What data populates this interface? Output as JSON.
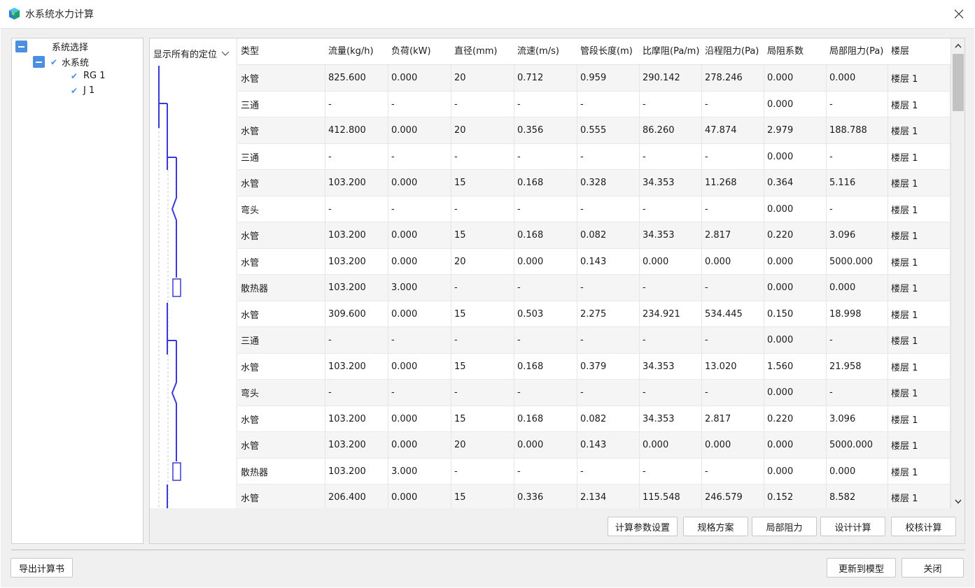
{
  "window": {
    "title": "水系统水力计算"
  },
  "tree": {
    "root_label": "系统选择",
    "system_label": "水系统",
    "children": [
      "RG 1",
      "J 1"
    ]
  },
  "diagram": {
    "header_label": "显示所有的定位"
  },
  "table": {
    "columns": [
      "类型",
      "流量(kg/h)",
      "负荷(kW)",
      "直径(mm)",
      "流速(m/s)",
      "管段长度(m)",
      "比摩阻(Pa/m)",
      "沿程阻力(Pa)",
      "局阻系数",
      "局部阻力(Pa)",
      "楼层"
    ],
    "rows": [
      [
        "水管",
        "825.600",
        "0.000",
        "20",
        "0.712",
        "0.959",
        "290.142",
        "278.246",
        "0.000",
        "0.000",
        "楼层 1"
      ],
      [
        "三通",
        "-",
        "-",
        "-",
        "-",
        "-",
        "-",
        "-",
        "0.000",
        "-",
        "楼层 1"
      ],
      [
        "水管",
        "412.800",
        "0.000",
        "20",
        "0.356",
        "0.555",
        "86.260",
        "47.874",
        "2.979",
        "188.788",
        "楼层 1"
      ],
      [
        "三通",
        "-",
        "-",
        "-",
        "-",
        "-",
        "-",
        "-",
        "0.000",
        "-",
        "楼层 1"
      ],
      [
        "水管",
        "103.200",
        "0.000",
        "15",
        "0.168",
        "0.328",
        "34.353",
        "11.268",
        "0.364",
        "5.116",
        "楼层 1"
      ],
      [
        "弯头",
        "-",
        "-",
        "-",
        "-",
        "-",
        "-",
        "-",
        "0.000",
        "-",
        "楼层 1"
      ],
      [
        "水管",
        "103.200",
        "0.000",
        "15",
        "0.168",
        "0.082",
        "34.353",
        "2.817",
        "0.220",
        "3.096",
        "楼层 1"
      ],
      [
        "水管",
        "103.200",
        "0.000",
        "20",
        "0.000",
        "0.143",
        "0.000",
        "0.000",
        "0.000",
        "5000.000",
        "楼层 1"
      ],
      [
        "散热器",
        "103.200",
        "3.000",
        "-",
        "-",
        "-",
        "-",
        "-",
        "0.000",
        "0.000",
        "楼层 1"
      ],
      [
        "水管",
        "309.600",
        "0.000",
        "15",
        "0.503",
        "2.275",
        "234.921",
        "534.445",
        "0.150",
        "18.998",
        "楼层 1"
      ],
      [
        "三通",
        "-",
        "-",
        "-",
        "-",
        "-",
        "-",
        "-",
        "0.000",
        "-",
        "楼层 1"
      ],
      [
        "水管",
        "103.200",
        "0.000",
        "15",
        "0.168",
        "0.379",
        "34.353",
        "13.020",
        "1.560",
        "21.958",
        "楼层 1"
      ],
      [
        "弯头",
        "-",
        "-",
        "-",
        "-",
        "-",
        "-",
        "-",
        "0.000",
        "-",
        "楼层 1"
      ],
      [
        "水管",
        "103.200",
        "0.000",
        "15",
        "0.168",
        "0.082",
        "34.353",
        "2.817",
        "0.220",
        "3.096",
        "楼层 1"
      ],
      [
        "水管",
        "103.200",
        "0.000",
        "20",
        "0.000",
        "0.143",
        "0.000",
        "0.000",
        "0.000",
        "5000.000",
        "楼层 1"
      ],
      [
        "散热器",
        "103.200",
        "3.000",
        "-",
        "-",
        "-",
        "-",
        "-",
        "0.000",
        "0.000",
        "楼层 1"
      ],
      [
        "水管",
        "206.400",
        "0.000",
        "15",
        "0.336",
        "2.134",
        "115.548",
        "246.579",
        "0.152",
        "8.582",
        "楼层 1"
      ]
    ]
  },
  "panel_buttons": {
    "calc_params": "计算参数设置",
    "spec_plan": "规格方案",
    "local_resist": "局部阻力",
    "design_calc": "设计计算",
    "check_calc": "校核计算"
  },
  "footer": {
    "export": "导出计算书",
    "update_model": "更新到模型",
    "close": "关闭"
  },
  "colors": {
    "accent": "#4a8fe0",
    "pipe_line": "#3a3ad9",
    "row_alt": "#f5f5f5"
  }
}
